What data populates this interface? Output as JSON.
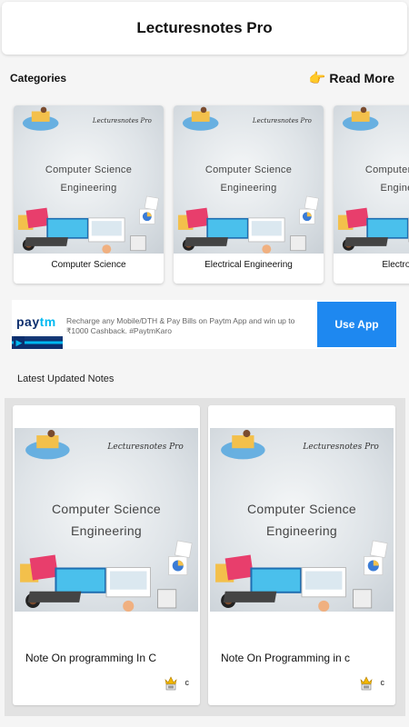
{
  "app": {
    "title": "Lecturesnotes Pro"
  },
  "categories": {
    "title": "Categories",
    "read_more": "Read More",
    "read_more_icon": "pointing-hand-icon",
    "thumb": {
      "brand": "Lecturesnotes Pro",
      "line1": "Computer Science",
      "line2": "Engineering"
    },
    "items": [
      {
        "label": "Computer Science"
      },
      {
        "label": "Electrical Engineering"
      },
      {
        "label": "Electronics &"
      }
    ]
  },
  "ad": {
    "logo_part1": "pay",
    "logo_part2": "tm",
    "text": "Recharge any Mobile/DTH & Pay Bills on Paytm App and win up to ₹1000 Cashback. #PaytmKaro",
    "button": "Use App",
    "button_color": "#1e88f0"
  },
  "latest": {
    "title": "Latest Updated Notes",
    "notes": [
      {
        "title": "Note On programming In C",
        "author": "c",
        "icon": "crown-badge-icon"
      },
      {
        "title": "Note On Programming in c",
        "author": "c",
        "icon": "crown-badge-icon"
      }
    ]
  }
}
